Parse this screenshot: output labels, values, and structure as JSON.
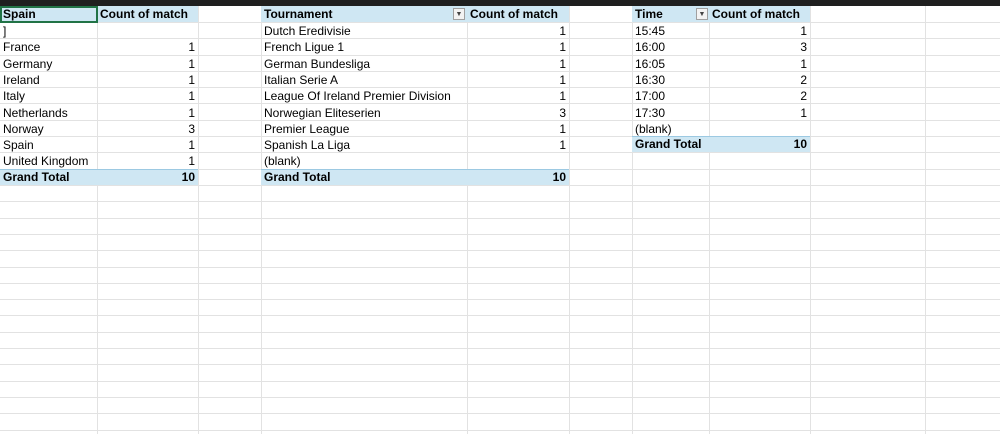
{
  "pivot_country": {
    "header_label": "Spain",
    "value_header": "Count of match",
    "rows": [
      {
        "label": "]",
        "value": ""
      },
      {
        "label": "France",
        "value": "1"
      },
      {
        "label": "Germany",
        "value": "1"
      },
      {
        "label": "Ireland",
        "value": "1"
      },
      {
        "label": "Italy",
        "value": "1"
      },
      {
        "label": "Netherlands",
        "value": "1"
      },
      {
        "label": "Norway",
        "value": "3"
      },
      {
        "label": "Spain",
        "value": "1"
      },
      {
        "label": "United Kingdom",
        "value": "1"
      }
    ],
    "total_label": "Grand Total",
    "total_value": "10"
  },
  "pivot_tournament": {
    "header_label": "Tournament",
    "value_header": "Count of match",
    "rows": [
      {
        "label": "Dutch Eredivisie",
        "value": "1"
      },
      {
        "label": "French Ligue 1",
        "value": "1"
      },
      {
        "label": "German Bundesliga",
        "value": "1"
      },
      {
        "label": "Italian Serie A",
        "value": "1"
      },
      {
        "label": "League Of Ireland Premier Division",
        "value": "1"
      },
      {
        "label": "Norwegian Eliteserien",
        "value": "3"
      },
      {
        "label": "Premier League",
        "value": "1"
      },
      {
        "label": "Spanish La Liga",
        "value": "1"
      },
      {
        "label": "(blank)",
        "value": ""
      }
    ],
    "total_label": "Grand Total",
    "total_value": "10"
  },
  "pivot_time": {
    "header_label": "Time",
    "value_header": "Count of match",
    "rows": [
      {
        "label": "15:45",
        "value": "1"
      },
      {
        "label": "16:00",
        "value": "3"
      },
      {
        "label": "16:05",
        "value": "1"
      },
      {
        "label": "16:30",
        "value": "2"
      },
      {
        "label": "17:00",
        "value": "2"
      },
      {
        "label": "17:30",
        "value": "1"
      },
      {
        "label": "(blank)",
        "value": ""
      }
    ],
    "total_label": "Grand Total",
    "total_value": "10"
  },
  "icons": {
    "filter_dropdown": "chevron-down-icon"
  },
  "colors": {
    "pivot_header_bg": "#cfe7f3",
    "gridline": "#e2e2e2",
    "selection": "#217346"
  }
}
